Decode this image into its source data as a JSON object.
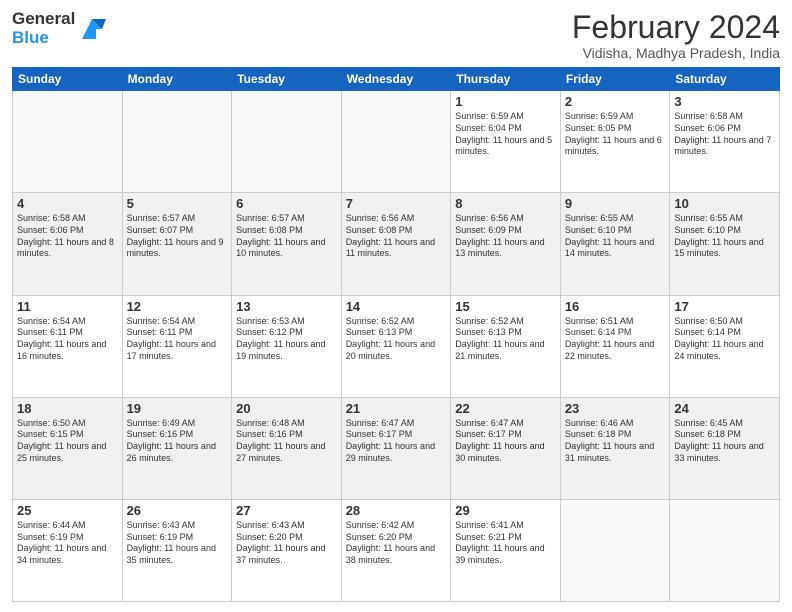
{
  "logo": {
    "line1": "General",
    "line2": "Blue"
  },
  "header": {
    "title": "February 2024",
    "location": "Vidisha, Madhya Pradesh, India"
  },
  "weekdays": [
    "Sunday",
    "Monday",
    "Tuesday",
    "Wednesday",
    "Thursday",
    "Friday",
    "Saturday"
  ],
  "weeks": [
    [
      {
        "day": "",
        "info": ""
      },
      {
        "day": "",
        "info": ""
      },
      {
        "day": "",
        "info": ""
      },
      {
        "day": "",
        "info": ""
      },
      {
        "day": "1",
        "info": "Sunrise: 6:59 AM\nSunset: 6:04 PM\nDaylight: 11 hours and 5 minutes."
      },
      {
        "day": "2",
        "info": "Sunrise: 6:59 AM\nSunset: 6:05 PM\nDaylight: 11 hours and 6 minutes."
      },
      {
        "day": "3",
        "info": "Sunrise: 6:58 AM\nSunset: 6:06 PM\nDaylight: 11 hours and 7 minutes."
      }
    ],
    [
      {
        "day": "4",
        "info": "Sunrise: 6:58 AM\nSunset: 6:06 PM\nDaylight: 11 hours and 8 minutes."
      },
      {
        "day": "5",
        "info": "Sunrise: 6:57 AM\nSunset: 6:07 PM\nDaylight: 11 hours and 9 minutes."
      },
      {
        "day": "6",
        "info": "Sunrise: 6:57 AM\nSunset: 6:08 PM\nDaylight: 11 hours and 10 minutes."
      },
      {
        "day": "7",
        "info": "Sunrise: 6:56 AM\nSunset: 6:08 PM\nDaylight: 11 hours and 11 minutes."
      },
      {
        "day": "8",
        "info": "Sunrise: 6:56 AM\nSunset: 6:09 PM\nDaylight: 11 hours and 13 minutes."
      },
      {
        "day": "9",
        "info": "Sunrise: 6:55 AM\nSunset: 6:10 PM\nDaylight: 11 hours and 14 minutes."
      },
      {
        "day": "10",
        "info": "Sunrise: 6:55 AM\nSunset: 6:10 PM\nDaylight: 11 hours and 15 minutes."
      }
    ],
    [
      {
        "day": "11",
        "info": "Sunrise: 6:54 AM\nSunset: 6:11 PM\nDaylight: 11 hours and 16 minutes."
      },
      {
        "day": "12",
        "info": "Sunrise: 6:54 AM\nSunset: 6:11 PM\nDaylight: 11 hours and 17 minutes."
      },
      {
        "day": "13",
        "info": "Sunrise: 6:53 AM\nSunset: 6:12 PM\nDaylight: 11 hours and 19 minutes."
      },
      {
        "day": "14",
        "info": "Sunrise: 6:52 AM\nSunset: 6:13 PM\nDaylight: 11 hours and 20 minutes."
      },
      {
        "day": "15",
        "info": "Sunrise: 6:52 AM\nSunset: 6:13 PM\nDaylight: 11 hours and 21 minutes."
      },
      {
        "day": "16",
        "info": "Sunrise: 6:51 AM\nSunset: 6:14 PM\nDaylight: 11 hours and 22 minutes."
      },
      {
        "day": "17",
        "info": "Sunrise: 6:50 AM\nSunset: 6:14 PM\nDaylight: 11 hours and 24 minutes."
      }
    ],
    [
      {
        "day": "18",
        "info": "Sunrise: 6:50 AM\nSunset: 6:15 PM\nDaylight: 11 hours and 25 minutes."
      },
      {
        "day": "19",
        "info": "Sunrise: 6:49 AM\nSunset: 6:16 PM\nDaylight: 11 hours and 26 minutes."
      },
      {
        "day": "20",
        "info": "Sunrise: 6:48 AM\nSunset: 6:16 PM\nDaylight: 11 hours and 27 minutes."
      },
      {
        "day": "21",
        "info": "Sunrise: 6:47 AM\nSunset: 6:17 PM\nDaylight: 11 hours and 29 minutes."
      },
      {
        "day": "22",
        "info": "Sunrise: 6:47 AM\nSunset: 6:17 PM\nDaylight: 11 hours and 30 minutes."
      },
      {
        "day": "23",
        "info": "Sunrise: 6:46 AM\nSunset: 6:18 PM\nDaylight: 11 hours and 31 minutes."
      },
      {
        "day": "24",
        "info": "Sunrise: 6:45 AM\nSunset: 6:18 PM\nDaylight: 11 hours and 33 minutes."
      }
    ],
    [
      {
        "day": "25",
        "info": "Sunrise: 6:44 AM\nSunset: 6:19 PM\nDaylight: 11 hours and 34 minutes."
      },
      {
        "day": "26",
        "info": "Sunrise: 6:43 AM\nSunset: 6:19 PM\nDaylight: 11 hours and 35 minutes."
      },
      {
        "day": "27",
        "info": "Sunrise: 6:43 AM\nSunset: 6:20 PM\nDaylight: 11 hours and 37 minutes."
      },
      {
        "day": "28",
        "info": "Sunrise: 6:42 AM\nSunset: 6:20 PM\nDaylight: 11 hours and 38 minutes."
      },
      {
        "day": "29",
        "info": "Sunrise: 6:41 AM\nSunset: 6:21 PM\nDaylight: 11 hours and 39 minutes."
      },
      {
        "day": "",
        "info": ""
      },
      {
        "day": "",
        "info": ""
      }
    ]
  ]
}
